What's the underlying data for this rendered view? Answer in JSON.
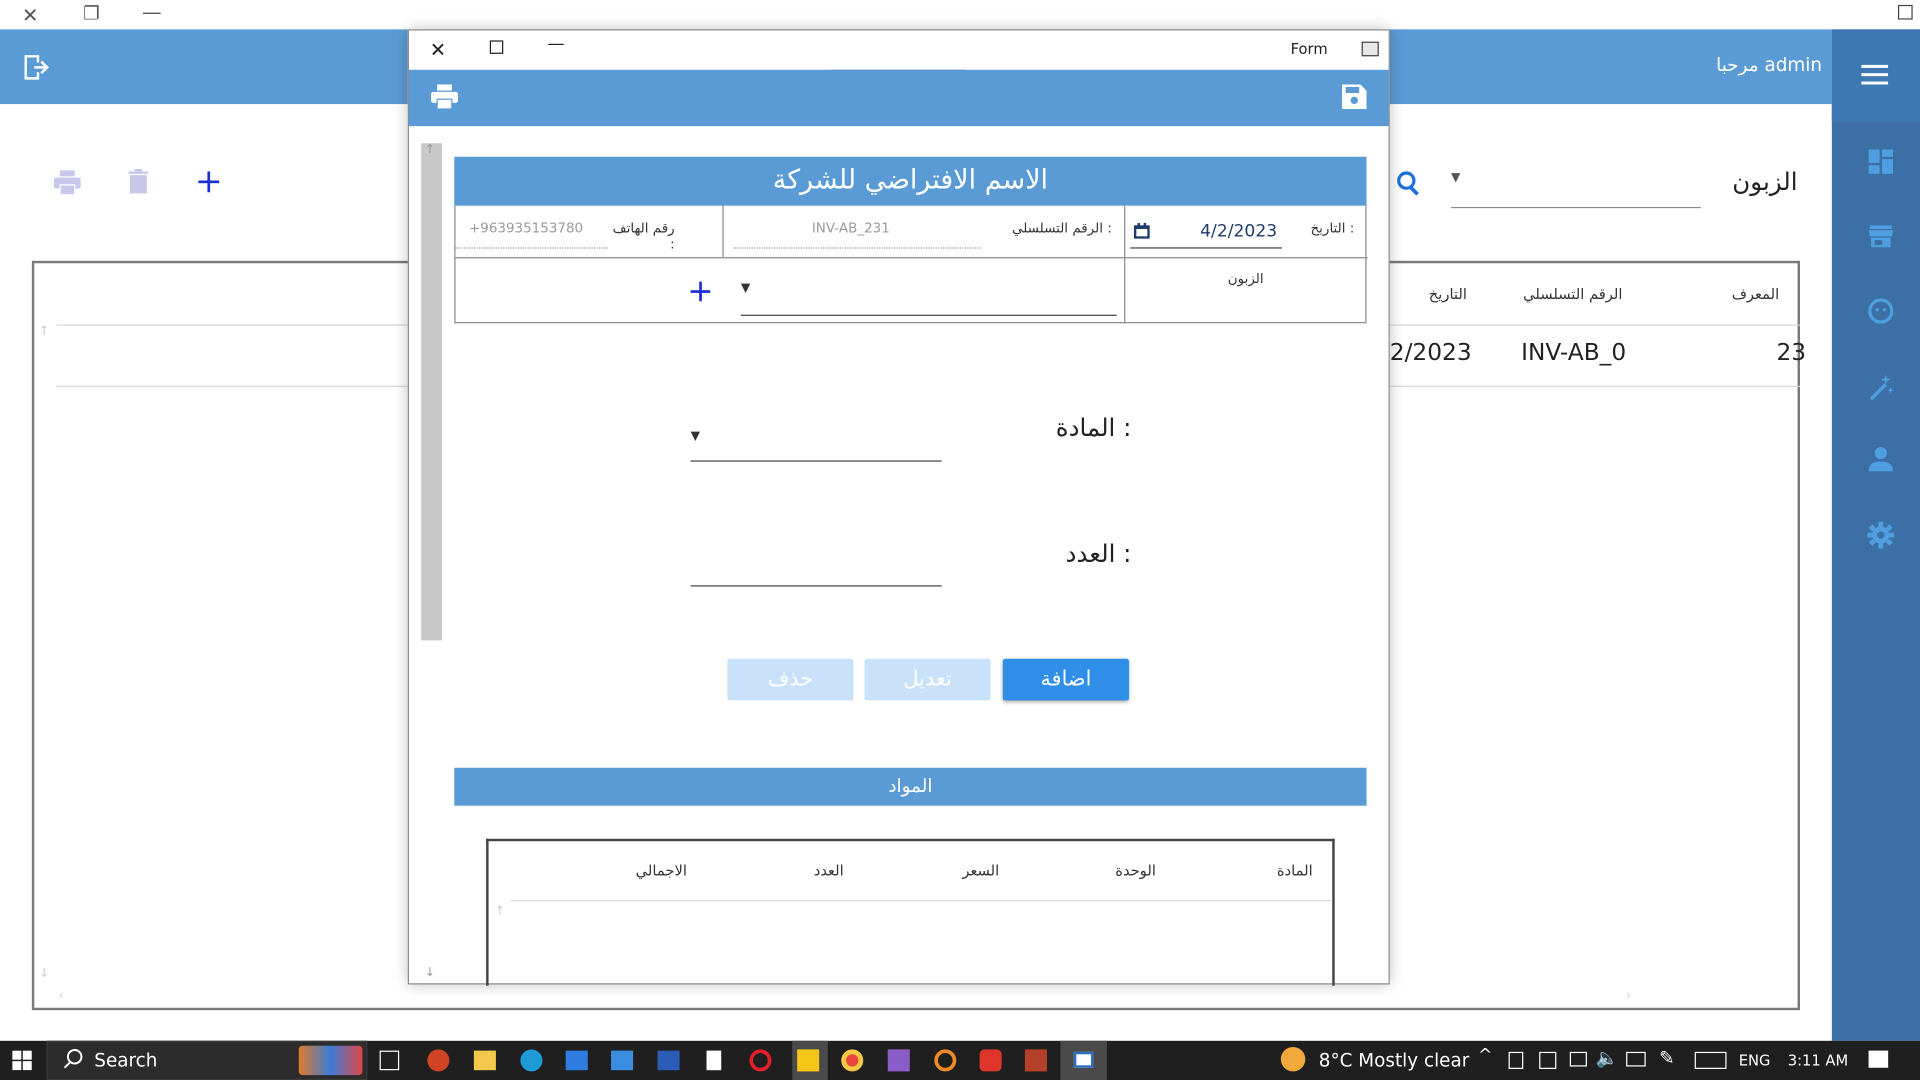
{
  "main_window": {
    "greeting": "مرحبا admin",
    "customer_label": "الزبون",
    "table": {
      "headers": [
        "المعرف",
        "الرقم التسلسلي",
        "التاريخ"
      ],
      "rows": [
        {
          "id": "23",
          "serial": "INV-AB_0",
          "date": "2/2023"
        }
      ]
    },
    "icons": {
      "logout": "logout-icon",
      "print": "print-icon",
      "delete": "trash-icon",
      "add": "plus-icon",
      "search": "search-icon",
      "menu": "hamburger-menu-icon",
      "dashboard": "dashboard-icon",
      "store": "store-icon",
      "face": "face-icon",
      "tools": "tools-icon",
      "person": "person-icon",
      "settings": "gear-icon"
    }
  },
  "dialog": {
    "title": "Form",
    "company_name": "الاسم الافتراضي للشركة",
    "date_label": "التاريخ :",
    "date_value": "4/2/2023",
    "serial_label": "الرقم التسلسلي :",
    "serial_value": "INV-AB_231",
    "phone_label": "رقم الهاتف :",
    "phone_value": "+963935153780",
    "customer_label": "الزبون",
    "material_label": "المادة :",
    "count_label": "العدد :",
    "buttons": {
      "add": "اضافة",
      "edit": "تعديل",
      "delete": "حذف"
    },
    "materials_section": "المواد",
    "materials_table": {
      "headers": [
        "المادة",
        "الوحدة",
        "السعر",
        "العدد",
        "الاجمالي"
      ]
    }
  },
  "taskbar": {
    "search_label": "Search",
    "weather": "8°C  Mostly clear",
    "language": "ENG",
    "time": "3:11 AM"
  },
  "colors": {
    "header_blue": "#5b9bd5",
    "rail_blue": "#3b6fa5",
    "button_blue": "#2f8ee8",
    "button_disabled": "#c9e2fa"
  }
}
